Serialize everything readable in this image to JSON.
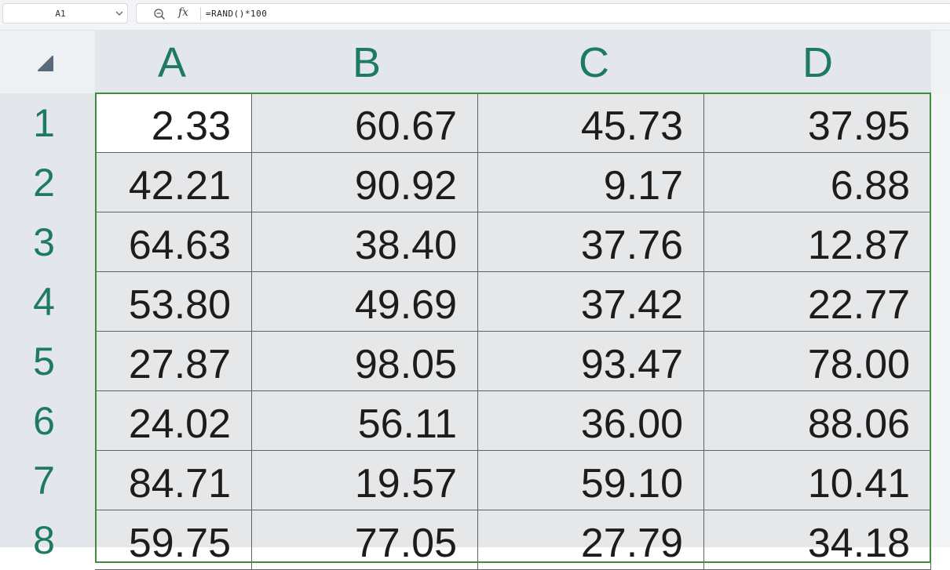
{
  "formula_bar": {
    "cell_reference": "A1",
    "formula": "=RAND()*100",
    "fx_label": "fx"
  },
  "icons": {
    "namebox_caret": "chevron-down-icon",
    "zoom": "zoom-icon",
    "select_all": "select-all-triangle-icon"
  },
  "colors": {
    "header_text": "#1e7a63",
    "selection_border": "#3f8a3c"
  },
  "columns": [
    "A",
    "B",
    "C",
    "D"
  ],
  "rows": [
    {
      "label": "1",
      "cells": [
        "2.33",
        "60.67",
        "45.73",
        "37.95"
      ]
    },
    {
      "label": "2",
      "cells": [
        "42.21",
        "90.92",
        "9.17",
        "6.88"
      ]
    },
    {
      "label": "3",
      "cells": [
        "64.63",
        "38.40",
        "37.76",
        "12.87"
      ]
    },
    {
      "label": "4",
      "cells": [
        "53.80",
        "49.69",
        "37.42",
        "22.77"
      ]
    },
    {
      "label": "5",
      "cells": [
        "27.87",
        "98.05",
        "93.47",
        "78.00"
      ]
    },
    {
      "label": "6",
      "cells": [
        "24.02",
        "56.11",
        "36.00",
        "88.06"
      ]
    },
    {
      "label": "7",
      "cells": [
        "84.71",
        "19.57",
        "59.10",
        "10.41"
      ]
    },
    {
      "label": "8",
      "cells": [
        "59.75",
        "77.05",
        "27.79",
        "34.18"
      ]
    }
  ]
}
